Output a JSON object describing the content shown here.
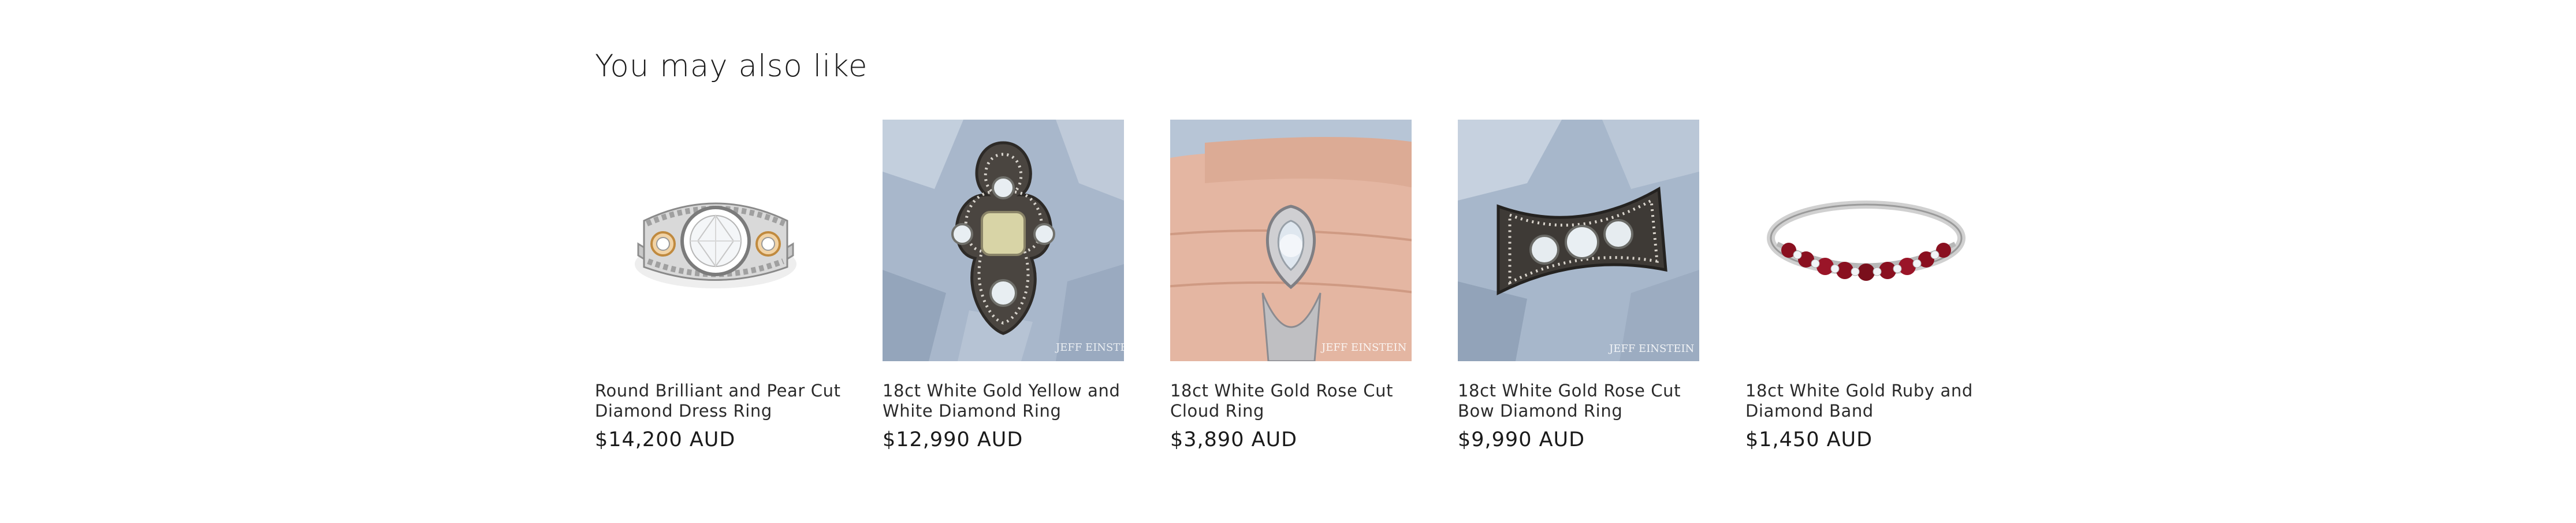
{
  "section": {
    "heading": "You may also like"
  },
  "products": [
    {
      "title_line1": "Round Brilliant and Pear Cut",
      "title_line2": "Diamond Dress Ring",
      "price": "$14,200 AUD",
      "image_icon": "ring-icon"
    },
    {
      "title_line1": "18ct White Gold Yellow and",
      "title_line2": "White Diamond Ring",
      "price": "$12,990 AUD",
      "image_icon": "ring-icon",
      "watermark": "JEFF EINSTEIN"
    },
    {
      "title_line1": "18ct White Gold Rose Cut",
      "title_line2": "Cloud Ring",
      "price": "$3,890 AUD",
      "image_icon": "ring-icon",
      "watermark": "JEFF EINSTEIN"
    },
    {
      "title_line1": "18ct White Gold Rose Cut",
      "title_line2": "Bow Diamond Ring",
      "price": "$9,990 AUD",
      "image_icon": "ring-icon",
      "watermark": "JEFF EINSTEIN"
    },
    {
      "title_line1": "18ct White Gold Ruby and",
      "title_line2": "Diamond Band",
      "price": "$1,450 AUD",
      "image_icon": "ring-icon"
    }
  ],
  "colors": {
    "text": "#121212",
    "crystal_bg": "#a9b8cc",
    "skin": "#e7b9a5",
    "ruby": "#8a1020",
    "gold": "#d9a25a"
  }
}
